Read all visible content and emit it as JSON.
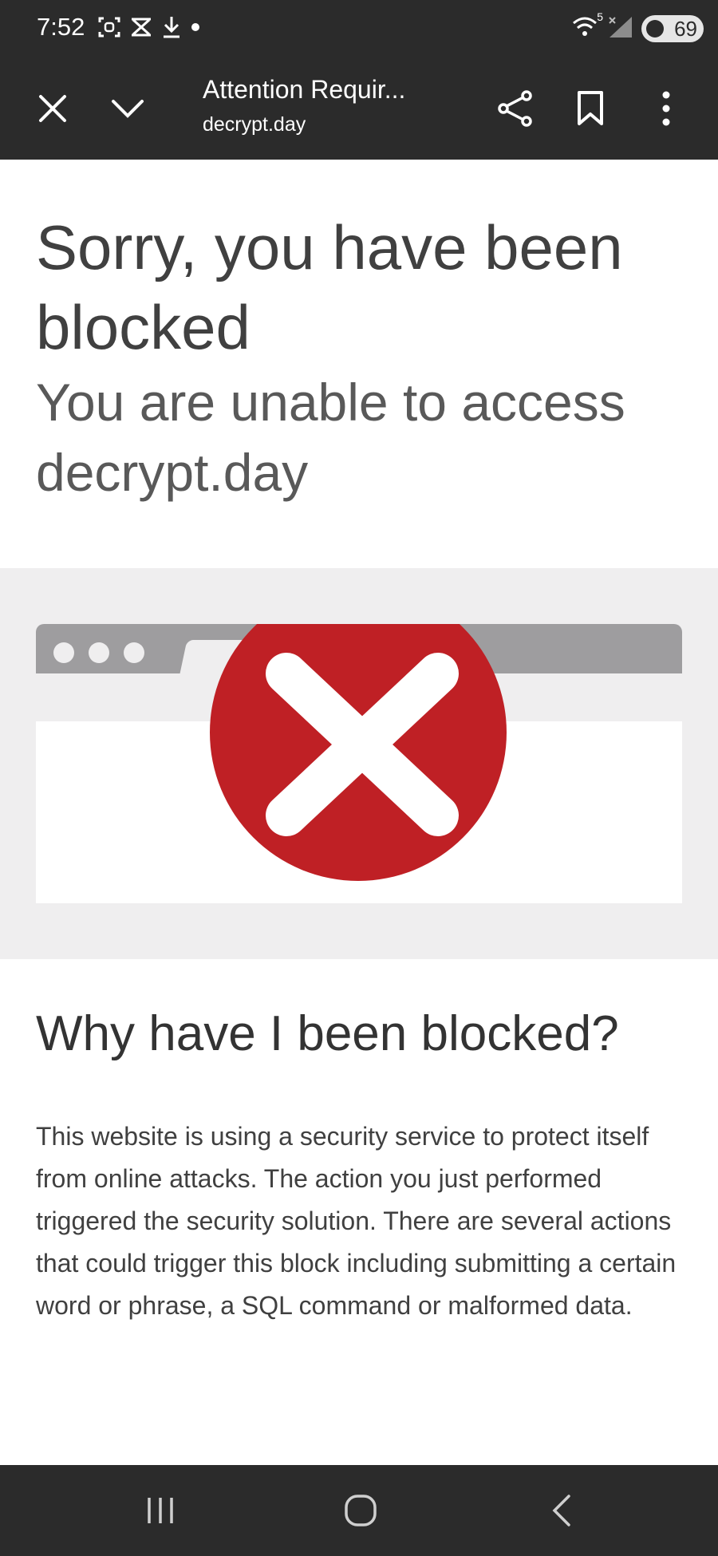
{
  "status_bar": {
    "time": "7:52",
    "battery_level": "69",
    "icons_left": [
      "screenshot-icon",
      "app-notification-icon",
      "download-icon",
      "dot-icon"
    ],
    "icons_right": [
      "wifi-icon",
      "cellular-signal-icon",
      "battery-icon"
    ],
    "wifi_label": "5"
  },
  "toolbar": {
    "title": "Attention Requir...",
    "url": "decrypt.day",
    "icons": [
      "close-icon",
      "chevron-down-icon",
      "share-icon",
      "bookmark-icon",
      "more-vert-icon"
    ]
  },
  "page": {
    "heading": "Sorry, you have been blocked",
    "subheading": "You are unable to access decrypt.day",
    "why_heading": "Why have I been blocked?",
    "why_body": "This website is using a security service to protect itself from online attacks. The action you just performed triggered the security solution. There are several actions that could trigger this block including submitting a certain word or phrase, a SQL command or malformed data."
  },
  "colors": {
    "error_red": "#bf2025",
    "chrome_dark": "#2b2b2b",
    "band_gray": "#efeeef",
    "browser_gray": "#9e9d9f"
  },
  "nav_bar": {
    "icons": [
      "recent-apps-icon",
      "home-icon",
      "back-icon"
    ]
  }
}
